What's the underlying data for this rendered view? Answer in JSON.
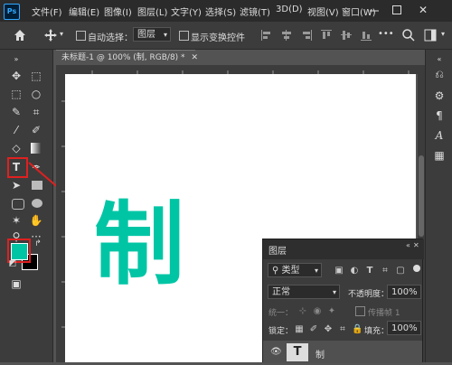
{
  "app": {
    "logo": "Ps"
  },
  "menu": [
    {
      "label": "文件(F)"
    },
    {
      "label": "编辑(E)"
    },
    {
      "label": "图像(I)"
    },
    {
      "label": "图层(L)"
    },
    {
      "label": "文字(Y)"
    },
    {
      "label": "选择(S)"
    },
    {
      "label": "滤镜(T)"
    },
    {
      "label": "3D(D)"
    },
    {
      "label": "视图(V)"
    },
    {
      "label": "窗口(W)"
    }
  ],
  "window_controls": {
    "close": "✕"
  },
  "options_bar": {
    "auto_select_label": "自动选择：",
    "auto_select_value": "图层",
    "show_transform_label": "显示变换控件"
  },
  "document": {
    "tab_title": "未标题-1 @ 100% (制, RGB/8) *",
    "canvas_text": "制",
    "text_color": "#00c5a5"
  },
  "layers_panel": {
    "tab": "图层",
    "filter_kind": "类型",
    "blend_mode": "正常",
    "opacity_label": "不透明度：",
    "opacity_value": "100%",
    "unify_label": "统一：",
    "propagate_label": "传播帧 1",
    "lock_label": "锁定：",
    "fill_label": "填充：",
    "fill_value": "100%",
    "layer_name": "制",
    "layer_thumb": "T"
  },
  "colors": {
    "foreground": "#00c5a5",
    "background": "#000000",
    "highlight": "#e02020"
  }
}
